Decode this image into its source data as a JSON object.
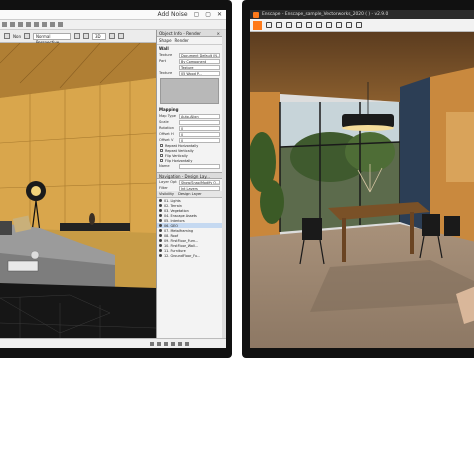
{
  "left_app": {
    "title_controls": [
      "Add Noise",
      "▢",
      "▢",
      "✕"
    ],
    "toolbar": {
      "class_label": "Non",
      "view_label": "Normal Perspective",
      "layer_label": "3D"
    },
    "palette": {
      "header": "Object Info - Render",
      "tabs": [
        "Shape",
        "Render"
      ],
      "object_type": "Wall",
      "rows": [
        {
          "label": "Texture",
          "value": "Document Default (N..."
        },
        {
          "label": "Part",
          "value": "By Component"
        },
        {
          "label": "",
          "value": "Texture"
        },
        {
          "label": "Texture",
          "value": "05 Wood P..."
        }
      ],
      "mapping_label": "Mapping",
      "mapping_rows": [
        {
          "label": "Map Type",
          "value": "Auto-Align"
        },
        {
          "label": "Scale",
          "value": ""
        },
        {
          "label": "Rotation",
          "value": "0"
        },
        {
          "label": "Offset H",
          "value": "0"
        },
        {
          "label": "Offset V",
          "value": "0"
        }
      ],
      "checks": [
        "Repeat Horizontally",
        "Repeat Vertically",
        "Flip Vertically",
        "Flip Horizontally"
      ],
      "name_label": "Name"
    },
    "navigation": {
      "header": "Navigation - Design Lay...",
      "layer_options_label": "Layer Options",
      "layer_options_value": "Show/Snap/Modify O...",
      "filter_label": "Filter",
      "filter_value": "Int Layers",
      "col_visibility": "Visibility",
      "col_design_layer": "Design Layer",
      "layers": [
        "01. Lights",
        "02. Terrain",
        "03. Vegetation",
        "04. Enscape Assets",
        "05. Interiors",
        "06. GEO",
        "07. Metalframing",
        "08. Roof",
        "09. FirstFloor_Furn...",
        "10. FirstFloor_Wall...",
        "11. Furniture",
        "12. GroundFloor_Fu..."
      ],
      "selected_index": 5
    }
  },
  "right_app": {
    "title": "Enscape - Enscape_sample_Vectorworks_2020 ( ) - v2.9.0"
  }
}
